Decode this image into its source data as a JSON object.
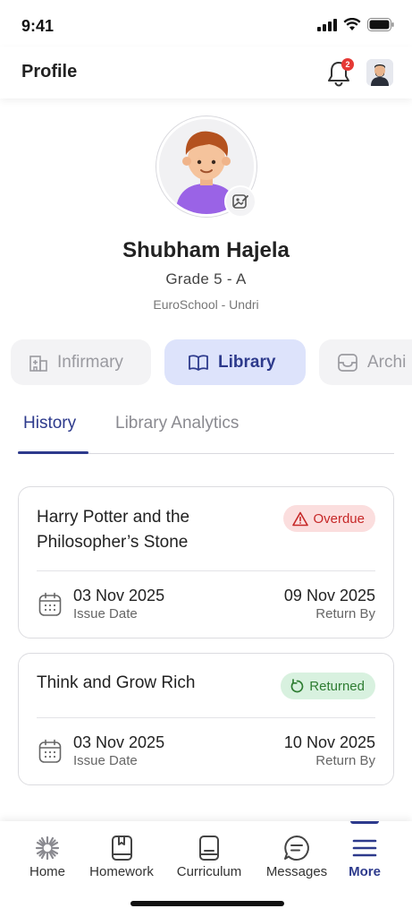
{
  "status_bar": {
    "time": "9:41"
  },
  "header": {
    "title": "Profile",
    "notification_count": "2"
  },
  "profile": {
    "name": "Shubham Hajela",
    "grade": "Grade 5 - A",
    "school": "EuroSchool - Undri"
  },
  "chips": [
    {
      "label": "Infirmary",
      "icon": "building-icon",
      "active": false
    },
    {
      "label": "Library",
      "icon": "open-book-icon",
      "active": true
    },
    {
      "label": "Archi",
      "icon": "inbox-icon",
      "active": false
    }
  ],
  "tabs": [
    {
      "label": "History",
      "active": true
    },
    {
      "label": "Library Analytics",
      "active": false
    }
  ],
  "books": [
    {
      "title": "Harry Potter and the Philosopher’s Stone",
      "status": "Overdue",
      "issue_date": "03 Nov 2025",
      "issue_label": "Issue Date",
      "return_date": "09 Nov 2025",
      "return_label": "Return By"
    },
    {
      "title": "Think and Grow Rich",
      "status": "Returned",
      "issue_date": "03 Nov 2025",
      "issue_label": "Issue Date",
      "return_date": "10 Nov 2025",
      "return_label": "Return By"
    }
  ],
  "bottom_nav": [
    {
      "label": "Home",
      "icon": "home-flower-icon",
      "active": false
    },
    {
      "label": "Homework",
      "icon": "homework-book-icon",
      "active": false
    },
    {
      "label": "Curriculum",
      "icon": "curriculum-icon",
      "active": false
    },
    {
      "label": "Messages",
      "icon": "message-bubble-icon",
      "active": false
    },
    {
      "label": "More",
      "icon": "menu-icon",
      "active": true
    }
  ],
  "colors": {
    "accent": "#2d3a8c",
    "active_chip_bg": "#dde3fb",
    "overdue_bg": "#fbdede",
    "overdue_text": "#c62828",
    "returned_bg": "#d8f1df",
    "returned_text": "#2e7d32"
  }
}
